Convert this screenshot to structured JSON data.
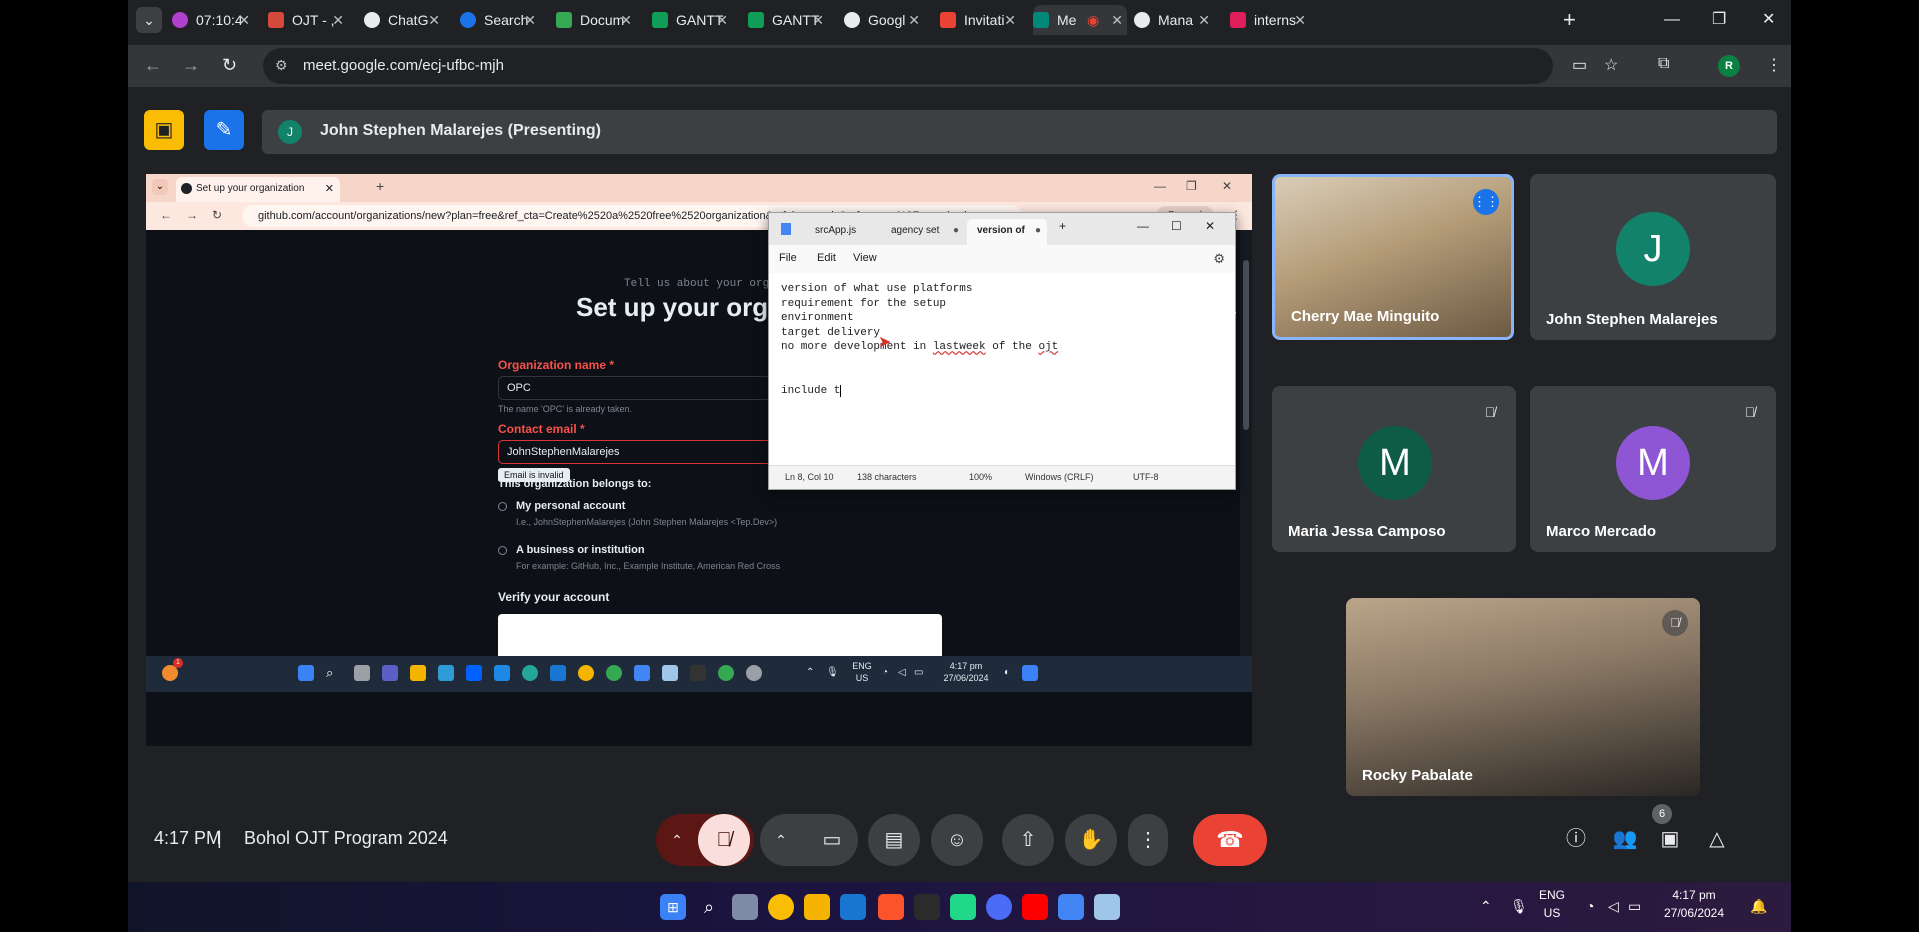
{
  "colors": {
    "meet_bg": "#202124",
    "end_call": "#ea4335",
    "accent_blue": "#1a73e8",
    "yellow": "#fbbc04"
  },
  "tabs": [
    {
      "label": "07:10:4",
      "icon": "timer-icon"
    },
    {
      "label": "OJT - ,",
      "icon": "sheet-icon"
    },
    {
      "label": "ChatG",
      "icon": "chatgpt-icon"
    },
    {
      "label": "Search",
      "icon": "search-app-icon"
    },
    {
      "label": "Docum",
      "icon": "docs-icon"
    },
    {
      "label": "GANTT",
      "icon": "sheets-icon"
    },
    {
      "label": "GANTT",
      "icon": "sheets-icon"
    },
    {
      "label": "Googl",
      "icon": "google-icon"
    },
    {
      "label": "Invitati",
      "icon": "gmail-icon"
    },
    {
      "label": "Me",
      "icon": "meet-icon"
    },
    {
      "label": "Mana",
      "icon": "github-icon"
    },
    {
      "label": "interns",
      "icon": "slack-icon"
    }
  ],
  "address": {
    "url": "meet.google.com/ecj-ufbc-mjh",
    "profile_initial": "R"
  },
  "meet": {
    "presenter_initial": "J",
    "presenting_text": "John Stephen Malarejes (Presenting)",
    "time": "4:17 PM",
    "separator": "|",
    "meeting_name": "Bohol OJT Program 2024",
    "participant_count": "6"
  },
  "shared": {
    "tab_title": "Set up your organization",
    "url": "github.com/account/organizations/new?plan=free&ref_cta=Create%2520a%2520free%2520organization&ref_loc=cards&ref_page=%2Forganizati",
    "paused": "Paused",
    "tell_us": "Tell us about your orga",
    "page_title": "Set up your orga",
    "org_label": "Organization name *",
    "org_value": "OPC",
    "org_note": "The name 'OPC' is already taken.",
    "email_label": "Contact email *",
    "email_value": "JohnStephenMalarejes",
    "email_error": "Email is invalid",
    "belongs_label": "This organization belongs to:",
    "opt1_title": "My personal account",
    "opt1_sub": "I.e., JohnStephenMalarejes (John Stephen Malarejes <Tep.Dev>)",
    "opt2_title": "A business or institution",
    "opt2_sub": "For example: GitHub, Inc., Example Institute, American Red Cross",
    "verify": "Verify your account",
    "taskbar": {
      "lang": "ENG",
      "region": "US",
      "time": "4:17 pm",
      "date": "27/06/2024",
      "notif_count": "1"
    }
  },
  "notepad": {
    "tabs": [
      "srcApp.js",
      "agency set",
      "version of"
    ],
    "menu": [
      "File",
      "Edit",
      "View"
    ],
    "lines": [
      "version of what use platforms",
      "requirement for the setup",
      "environment",
      "target delivery",
      "no more development in ",
      "",
      "",
      "include t"
    ],
    "line5_sq1": "lastweek",
    "line5_mid": " of the ",
    "line5_sq2": "ojt",
    "status": {
      "pos": "Ln 8, Col 10",
      "chars": "138 characters",
      "zoom": "100%",
      "eol": "Windows (CRLF)",
      "enc": "UTF-8"
    }
  },
  "participants": [
    {
      "name": "Cherry Mae Minguito",
      "type": "video",
      "speaking": true
    },
    {
      "name": "John Stephen Malarejes",
      "initial": "J",
      "color": "#12836a"
    },
    {
      "name": "Maria Jessa Camposo",
      "initial": "M",
      "color": "#0f5c46",
      "muted": true
    },
    {
      "name": "Marco Mercado",
      "initial": "M",
      "color": "#8e55d4",
      "muted": true
    },
    {
      "name": "Rocky Pabalate",
      "type": "video",
      "muted": true
    }
  ],
  "win_taskbar": {
    "lang": "ENG",
    "region": "US",
    "time": "4:17 pm",
    "date": "27/06/2024"
  }
}
